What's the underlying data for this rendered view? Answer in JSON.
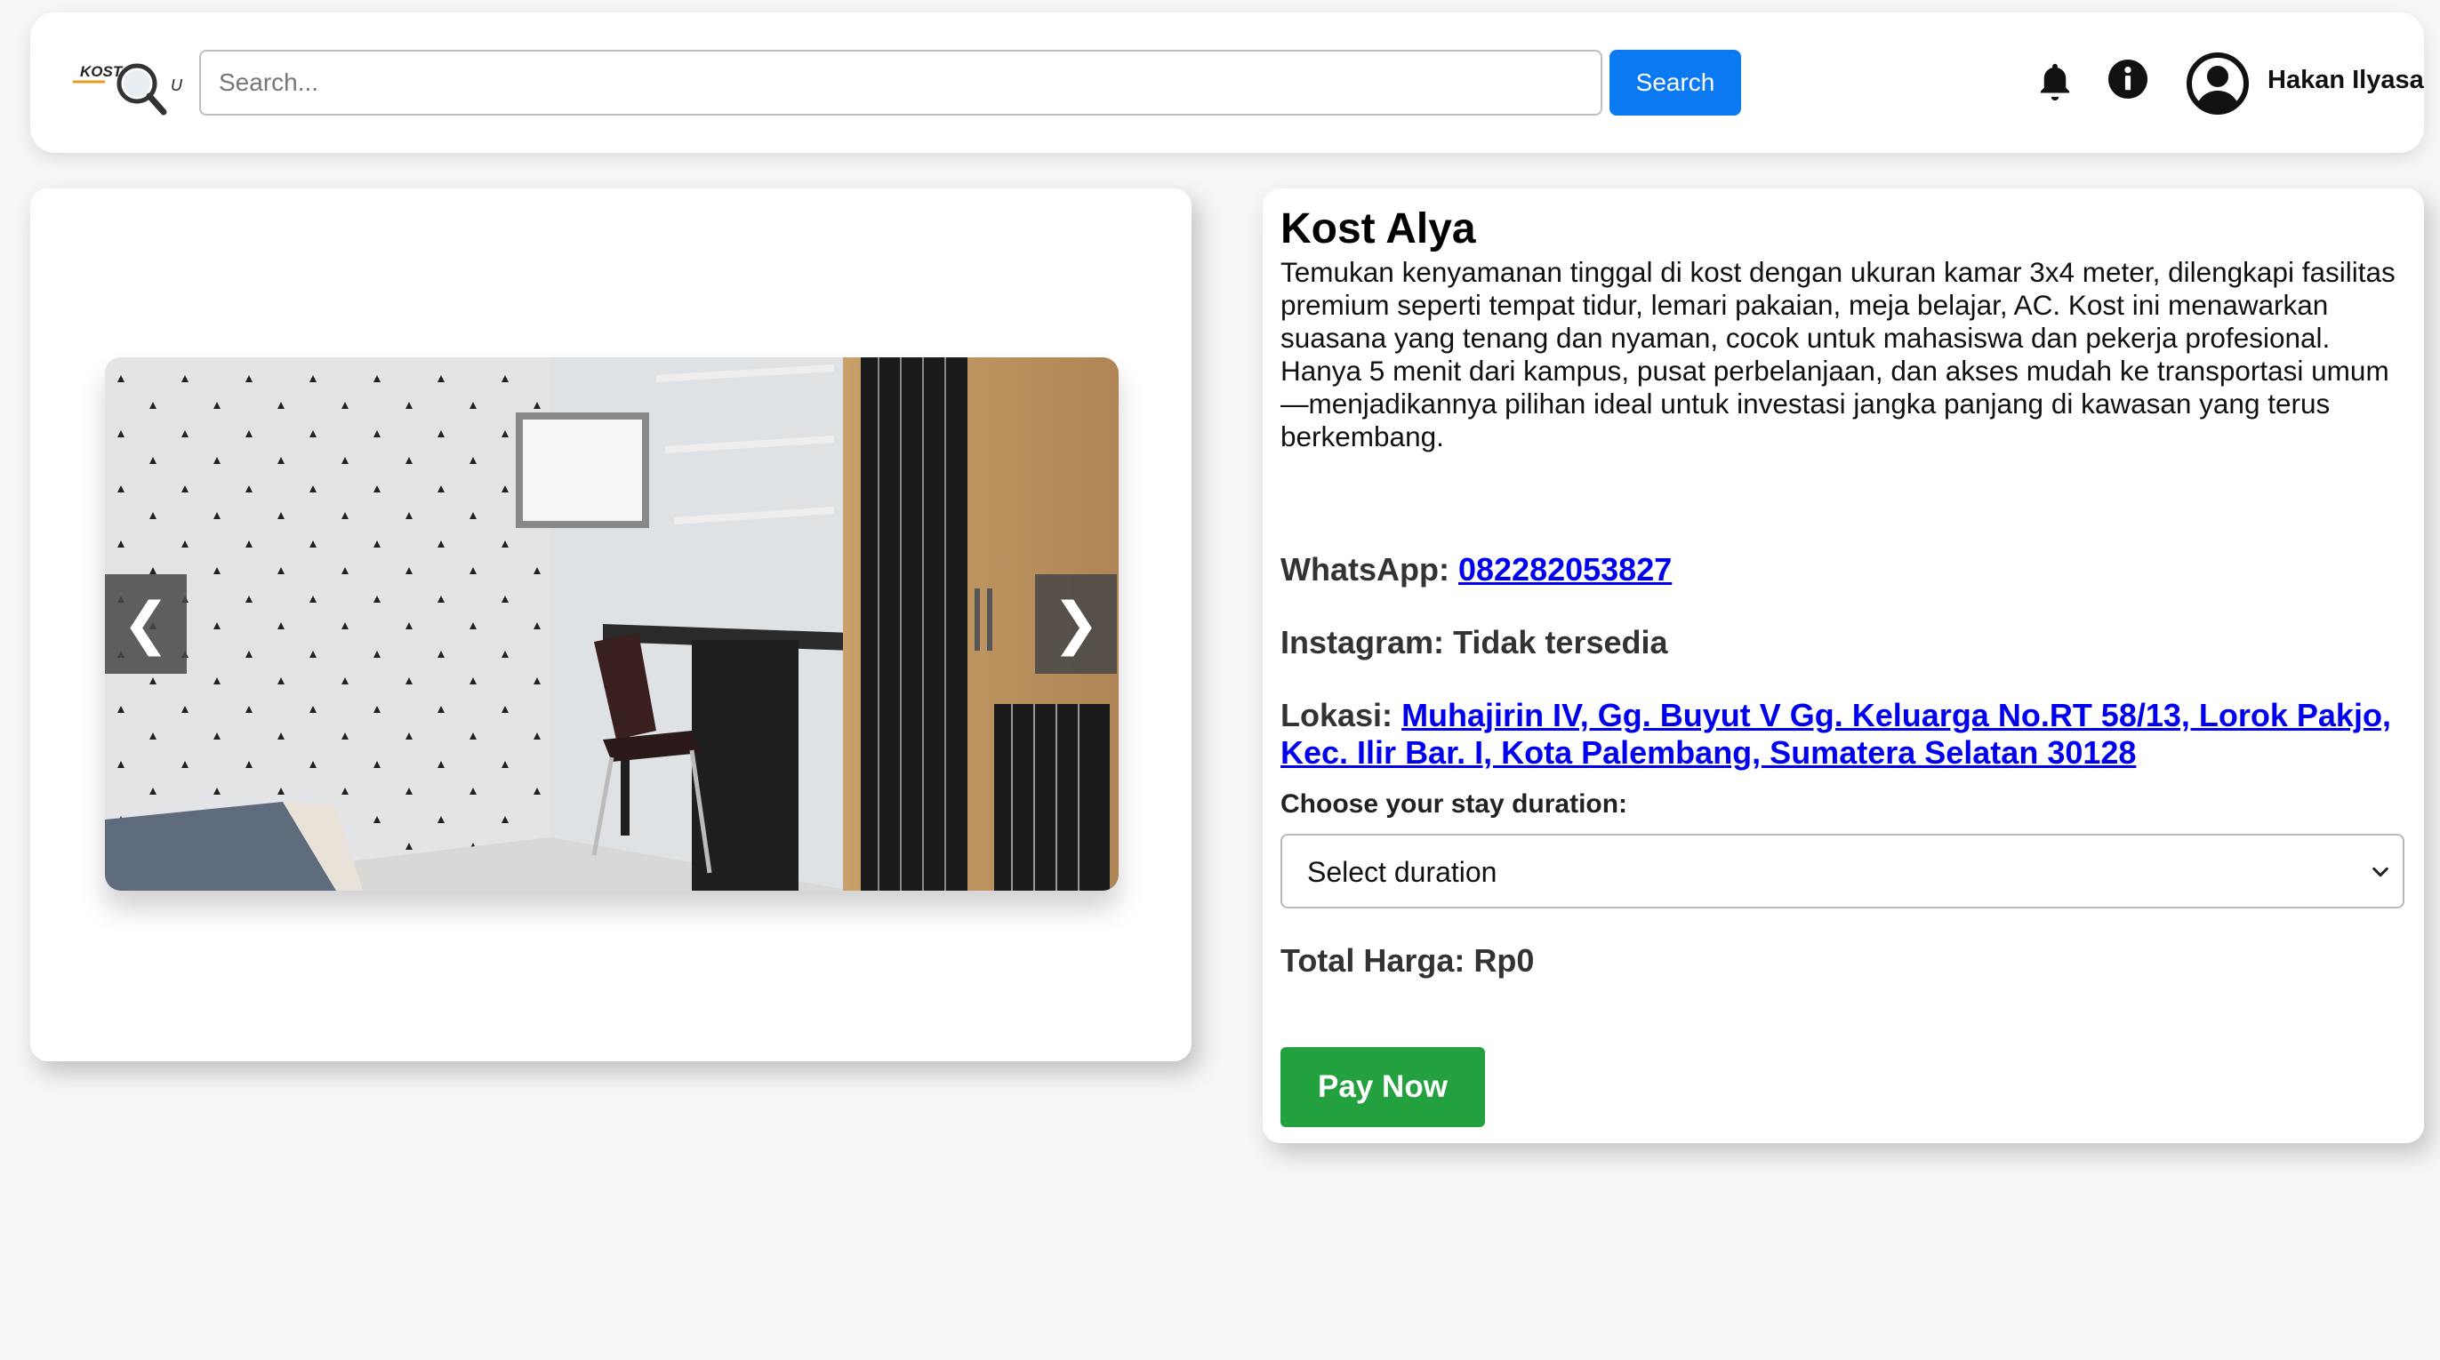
{
  "header": {
    "logo_text": "KOSTQU",
    "search_placeholder": "Search...",
    "search_button": "Search",
    "user_name": "Hakan Ilyasa"
  },
  "icons": {
    "logo": "magnifier-logo-icon",
    "bell": "bell-icon",
    "info": "info-icon",
    "avatar": "user-circle-icon",
    "prev": "chevron-left-icon",
    "next": "chevron-right-icon",
    "select": "chevron-down-icon"
  },
  "gallery": {
    "prev_symbol": "❮",
    "next_symbol": "❯"
  },
  "kost": {
    "name": "Kost Alya",
    "description": "Temukan kenyamanan tinggal di kost dengan ukuran kamar 3x4 meter, dilengkapi fasilitas premium seperti tempat tidur, lemari pakaian, meja belajar, AC. Kost ini menawarkan suasana yang tenang dan nyaman, cocok untuk mahasiswa dan pekerja profesional. Hanya 5 menit dari kampus, pusat perbelanjaan, dan akses mudah ke transportasi umum—menjadikannya pilihan ideal untuk investasi jangka panjang di kawasan yang terus berkembang.",
    "whatsapp_label": "WhatsApp:",
    "whatsapp_value": "082282053827",
    "instagram_label": "Instagram:",
    "instagram_value": "Tidak tersedia",
    "location_label": "Lokasi:",
    "location_value": "Muhajirin IV, Gg. Buyut V Gg. Keluarga No.RT 58/13, Lorok Pakjo, Kec. Ilir Bar. I, Kota Palembang, Sumatera Selatan 30128",
    "duration_label": "Choose your stay duration:",
    "duration_selected": "Select duration",
    "total_label": "Total Harga:",
    "total_value": "Rp0",
    "pay_button": "Pay Now"
  },
  "colors": {
    "primary": "#0b79f2",
    "pay": "#23a13f",
    "link": "#0000ee",
    "background": "#f6f6f6"
  }
}
